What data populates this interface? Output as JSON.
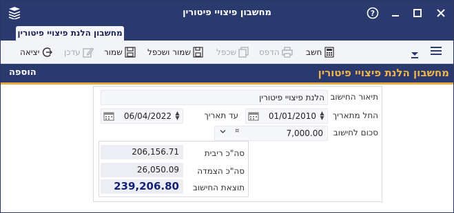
{
  "window": {
    "title": "מחשבון פיצויי פיטורין",
    "controls": {
      "help": "?",
      "minimize": "—",
      "maximize": "☐",
      "close": "✕"
    }
  },
  "tabs": [
    {
      "label": "מחשבון הלנת פיצויי פיטורין",
      "active": true
    }
  ],
  "toolbar": {
    "calculate": "חשב",
    "print": "הדפס",
    "duplicate": "שכפל",
    "save_and_duplicate": "שמור ושכפל",
    "save": "שמור",
    "update": "עדכן",
    "exit": "יציאה"
  },
  "section": {
    "title": "מחשבון הלנת פיצויי פיטורין",
    "mode": "הוספה"
  },
  "form": {
    "description": {
      "label": "תיאור החישוב",
      "value": "הלנת פיצויי פיטורין"
    },
    "from_date": {
      "label": "החל מתאריך",
      "value": "01/01/2010"
    },
    "to_date": {
      "label": "עד תאריך",
      "value": "06/04/2022"
    },
    "amount": {
      "label": "סכום לחישוב",
      "value": "7,000.00",
      "currency_symbol": "¤"
    }
  },
  "summary": {
    "interest": {
      "label": "סה\"כ ריבית",
      "value": "206,156.71"
    },
    "linkage": {
      "label": "סה\"כ הצמדה",
      "value": "26,050.09"
    },
    "result": {
      "label": "תוצאת החישוב",
      "value": "239,206.80"
    }
  },
  "colors": {
    "titlebar": "#2b3a6e",
    "accent": "#e8a93c",
    "section_title": "#f0b54a",
    "total_text": "#14237a"
  }
}
